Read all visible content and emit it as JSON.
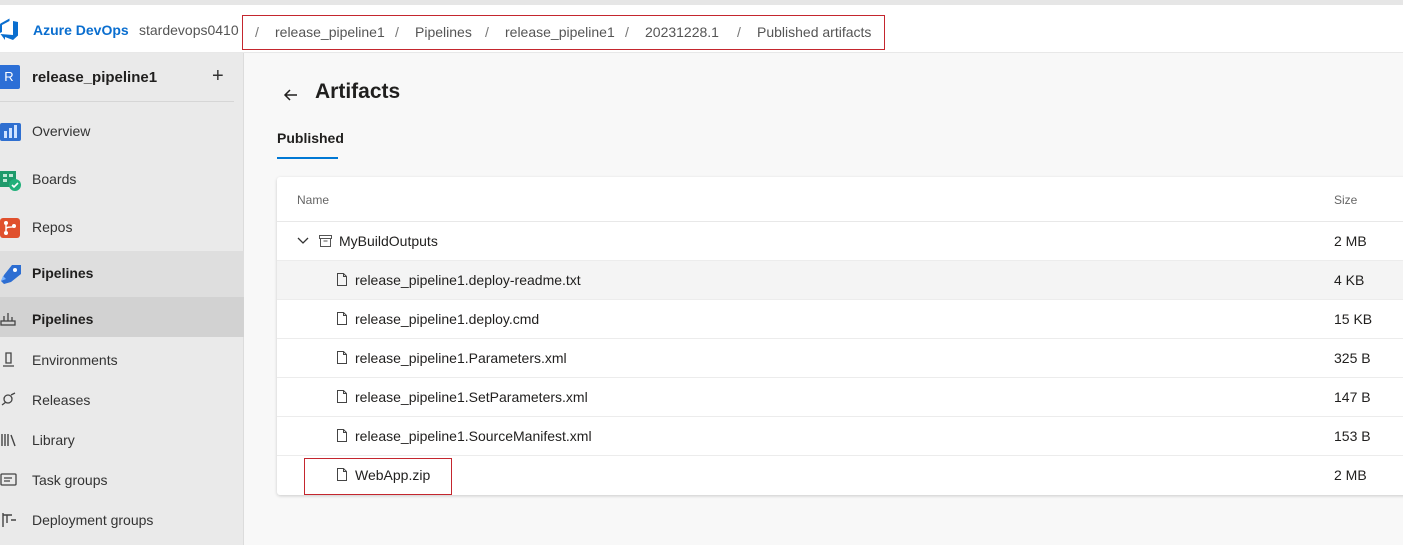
{
  "header": {
    "brand": "Azure DevOps",
    "org": "stardevops0410",
    "breadcrumbs": [
      "release_pipeline1",
      "Pipelines",
      "release_pipeline1",
      "20231228.1",
      "Published artifacts"
    ],
    "separator": "/"
  },
  "sidebar": {
    "project_initial": "R",
    "project_name": "release_pipeline1",
    "add_label": "+",
    "items": [
      {
        "label": "Overview",
        "icon": "overview-icon"
      },
      {
        "label": "Boards",
        "icon": "boards-icon"
      },
      {
        "label": "Repos",
        "icon": "repos-icon"
      },
      {
        "label": "Pipelines",
        "icon": "pipelines-icon"
      },
      {
        "label": "Pipelines",
        "icon": "pipelines-sub-icon"
      },
      {
        "label": "Environments",
        "icon": "environments-icon"
      },
      {
        "label": "Releases",
        "icon": "releases-icon"
      },
      {
        "label": "Library",
        "icon": "library-icon"
      },
      {
        "label": "Task groups",
        "icon": "task-groups-icon"
      },
      {
        "label": "Deployment groups",
        "icon": "deployment-groups-icon"
      }
    ]
  },
  "main": {
    "title": "Artifacts",
    "tab": "Published",
    "columns": {
      "name": "Name",
      "size": "Size"
    },
    "folder": {
      "name": "MyBuildOutputs",
      "size": "2 MB"
    },
    "files": [
      {
        "name": "release_pipeline1.deploy-readme.txt",
        "size": "4 KB"
      },
      {
        "name": "release_pipeline1.deploy.cmd",
        "size": "15 KB"
      },
      {
        "name": "release_pipeline1.Parameters.xml",
        "size": "325 B"
      },
      {
        "name": "release_pipeline1.SetParameters.xml",
        "size": "147 B"
      },
      {
        "name": "release_pipeline1.SourceManifest.xml",
        "size": "153 B"
      },
      {
        "name": "WebApp.zip",
        "size": "2 MB"
      }
    ]
  },
  "colors": {
    "accent": "#0078d4",
    "brand": "#0a6ecf",
    "highlight_border": "#c4262e"
  }
}
